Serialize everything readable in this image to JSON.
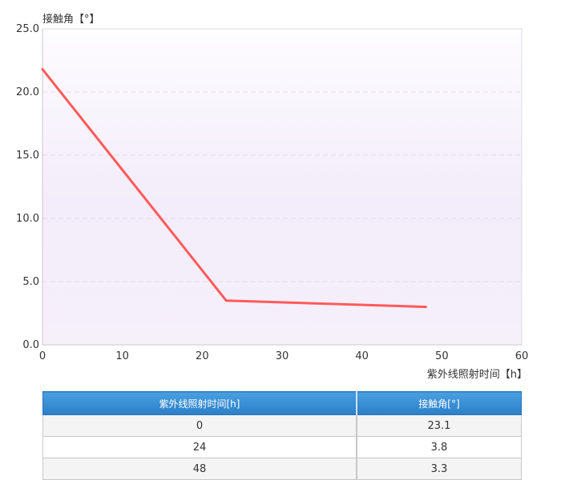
{
  "chart_data": {
    "type": "line",
    "ylabel": "接触角【°】",
    "xlabel": "紫外线照射时间【h】",
    "xlim": [
      0,
      60
    ],
    "ylim": [
      0,
      25
    ],
    "xticks": [
      0,
      10,
      20,
      30,
      40,
      50,
      60
    ],
    "yticks": [
      0,
      5,
      10,
      15,
      20,
      25
    ],
    "ytick_labels": [
      "0.0",
      "5.0",
      "10.0",
      "15.0",
      "20.0",
      "25.0"
    ],
    "grid": true,
    "series": [
      {
        "x": [
          0,
          23,
          48
        ],
        "y": [
          21.8,
          3.5,
          3.0
        ],
        "color": "#ff5a5a"
      }
    ]
  },
  "table": {
    "headers": [
      "紫外线照射时间[h]",
      "接触角[°]"
    ],
    "rows": [
      [
        "0",
        "23.1"
      ],
      [
        "24",
        "3.8"
      ],
      [
        "48",
        "3.3"
      ]
    ]
  },
  "colors": {
    "line": "#ff5a5a",
    "header_bg": "#3a8fd6",
    "plot_tint": "#efe6f8"
  }
}
